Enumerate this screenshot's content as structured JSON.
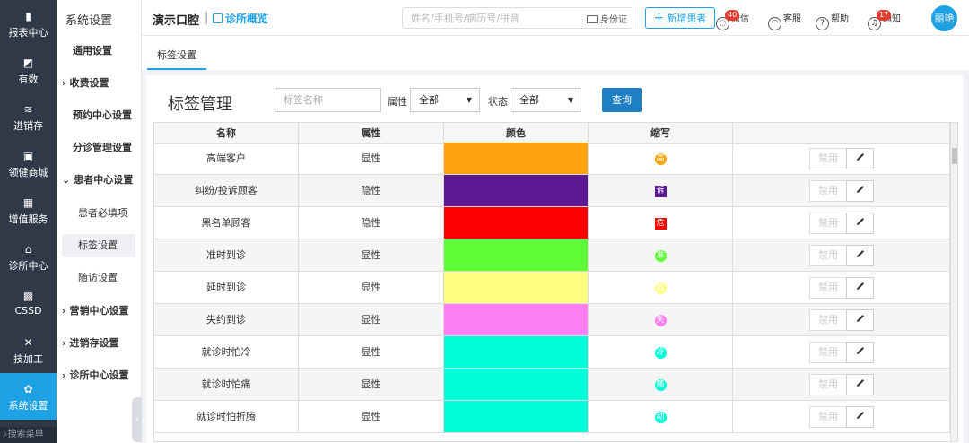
{
  "nav": {
    "items": [
      {
        "label": "报表中心",
        "icon": "bar-chart-icon",
        "glyph": "▮"
      },
      {
        "label": "有数",
        "icon": "line-chart-icon",
        "glyph": "◩"
      },
      {
        "label": "进销存",
        "icon": "layers-icon",
        "glyph": "≋"
      },
      {
        "label": "领健商城",
        "icon": "shop-icon",
        "glyph": "▣"
      },
      {
        "label": "增值服务",
        "icon": "apps-grid-icon",
        "glyph": "▦"
      },
      {
        "label": "诊所中心",
        "icon": "clinic-house-icon",
        "glyph": "⌂"
      },
      {
        "label": "CSSD",
        "icon": "sterilizer-icon",
        "glyph": "▩"
      },
      {
        "label": "技加工",
        "icon": "tools-icon",
        "glyph": "✕"
      },
      {
        "label": "系统设置",
        "icon": "gear-icon",
        "glyph": "✿"
      }
    ],
    "active_index": 8,
    "search_label": "搜索菜单"
  },
  "subnav": {
    "title": "系统设置",
    "items": [
      {
        "label": "通用设置",
        "type": "item"
      },
      {
        "label": "收费设置",
        "type": "group",
        "prefix": "›"
      },
      {
        "label": "预约中心设置",
        "type": "item"
      },
      {
        "label": "分诊管理设置",
        "type": "item"
      },
      {
        "label": "患者中心设置",
        "type": "group",
        "prefix": "⌄"
      },
      {
        "label": "患者必填项",
        "type": "child"
      },
      {
        "label": "标签设置",
        "type": "child",
        "selected": true
      },
      {
        "label": "随访设置",
        "type": "child"
      },
      {
        "label": "营销中心设置",
        "type": "group",
        "prefix": "›"
      },
      {
        "label": "进销存设置",
        "type": "group",
        "prefix": "›"
      },
      {
        "label": "诊所中心设置",
        "type": "group",
        "prefix": "›"
      }
    ]
  },
  "header": {
    "clinic_name": "演示口腔",
    "separator": "|",
    "overview_label": "诊所概览",
    "search_placeholder": "姓名/手机号/病历号/拼音",
    "idcard_label": "身份证",
    "new_patient_label": "新增患者",
    "tools": [
      {
        "label": "微信",
        "icon": "wechat-icon",
        "badge": "40"
      },
      {
        "label": "客服",
        "icon": "headset-icon",
        "badge": ""
      },
      {
        "label": "帮助",
        "icon": "help-icon",
        "badge": ""
      },
      {
        "label": "通知",
        "icon": "bell-icon",
        "badge": "17"
      }
    ],
    "avatar_text": "丽艳"
  },
  "tabs": [
    {
      "label": "标签设置",
      "active": true
    }
  ],
  "page": {
    "title": "标签管理",
    "name_placeholder": "标签名称",
    "attr_label": "属性",
    "attr_value": "全部",
    "status_label": "状态",
    "status_value": "全部",
    "query_label": "查询"
  },
  "table": {
    "columns": [
      "名称",
      "属性",
      "颜色",
      "缩写",
      ""
    ],
    "disable_label": "禁用",
    "rows": [
      {
        "name": "高端客户",
        "attr": "显性",
        "color": "#ffa30f",
        "abbr": "高",
        "shape": "circle"
      },
      {
        "name": "纠纷/投诉顾客",
        "attr": "隐性",
        "color": "#5b1a94",
        "abbr": "诉",
        "shape": "square"
      },
      {
        "name": "黑名单顾客",
        "attr": "隐性",
        "color": "#ff0000",
        "abbr": "危",
        "shape": "square"
      },
      {
        "name": "准时到诊",
        "attr": "显性",
        "color": "#5dfd35",
        "abbr": "准",
        "shape": "circle"
      },
      {
        "name": "延时到诊",
        "attr": "显性",
        "color": "#fefe7e",
        "abbr": "延",
        "shape": "circle"
      },
      {
        "name": "失约到诊",
        "attr": "显性",
        "color": "#fc7ff4",
        "abbr": "失",
        "shape": "circle"
      },
      {
        "name": "就诊时怕冷",
        "attr": "显性",
        "color": "#00ffd6",
        "abbr": "冷",
        "shape": "circle"
      },
      {
        "name": "就诊时怕痛",
        "attr": "显性",
        "color": "#00ffd6",
        "abbr": "痛",
        "shape": "circle"
      },
      {
        "name": "就诊时怕折腾",
        "attr": "显性",
        "color": "#00ffd6",
        "abbr": "动",
        "shape": "circle"
      }
    ]
  }
}
